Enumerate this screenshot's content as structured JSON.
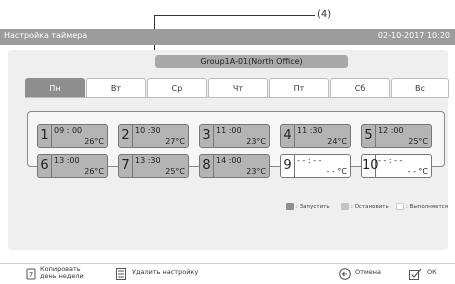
{
  "window": {
    "title": "Настройка таймера",
    "datetime": "02-10-2017  10:20"
  },
  "callout": {
    "label": "(4)"
  },
  "group_label": "Group1A-01(North Office)",
  "tabs": [
    "Пн",
    "Вт",
    "Ср",
    "Чт",
    "Пт",
    "Сб",
    "Вс"
  ],
  "slots": [
    {
      "num": "1",
      "time": "09 : 00",
      "temp": "26°C",
      "set": true
    },
    {
      "num": "2",
      "time": "10 :30",
      "temp": "27°C",
      "set": true
    },
    {
      "num": "3",
      "time": "11 :00",
      "temp": "23°C",
      "set": true
    },
    {
      "num": "4",
      "time": "11 :30",
      "temp": "24°C",
      "set": true
    },
    {
      "num": "5",
      "time": "12 :00",
      "temp": "25°C",
      "set": true
    },
    {
      "num": "6",
      "time": "13 :00",
      "temp": "26°C",
      "set": true
    },
    {
      "num": "7",
      "time": "13 :30",
      "temp": "25°C",
      "set": true
    },
    {
      "num": "8",
      "time": "14 :00",
      "temp": "23°C",
      "set": true
    },
    {
      "num": "9",
      "time": "- - : - -",
      "temp": "- - °C",
      "set": false
    },
    {
      "num": "10",
      "time": "- - : - -",
      "temp": "- - °C",
      "set": false
    }
  ],
  "legend": [
    {
      "label": ": Запустить",
      "color": "#8e8e8e"
    },
    {
      "label": ": Остановить",
      "color": "#c4c4c4"
    },
    {
      "label": ": Выполняется",
      "color": "#ffffff"
    }
  ],
  "bottom": {
    "copy_line1": "Копировать",
    "copy_line2": "день недели",
    "delete": "Удалить настройку",
    "cancel": "Отмена",
    "ok": "ОК"
  },
  "colors": {
    "titlebar": "#9c9c9c",
    "active_tab": "#8e8e8e",
    "slot_set": "#b4b4b4",
    "panel": "#efefef"
  }
}
